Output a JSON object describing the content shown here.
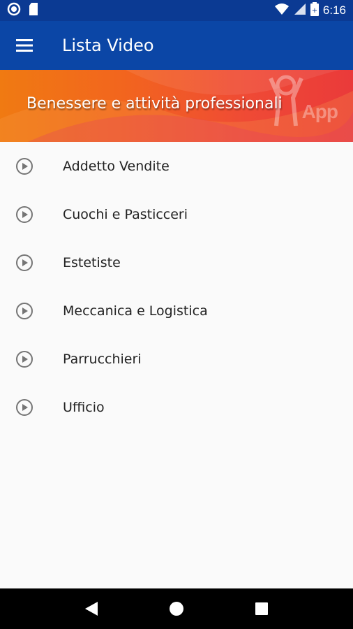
{
  "status_bar": {
    "time": "6:16",
    "icons": [
      "record-icon",
      "sd-card-icon",
      "wifi-icon",
      "signal-icon",
      "battery-icon"
    ]
  },
  "app_bar": {
    "title": "Lista Video",
    "menu_icon": "hamburger-menu-icon"
  },
  "banner": {
    "title": "Benessere e attività professionali",
    "logo_text": "App"
  },
  "video_list": {
    "items": [
      {
        "label": "Addetto Vendite",
        "icon": "play-circle-icon"
      },
      {
        "label": "Cuochi e Pasticceri",
        "icon": "play-circle-icon"
      },
      {
        "label": "Estetiste",
        "icon": "play-circle-icon"
      },
      {
        "label": "Meccanica e Logistica",
        "icon": "play-circle-icon"
      },
      {
        "label": "Parrucchieri",
        "icon": "play-circle-icon"
      },
      {
        "label": "Ufficio",
        "icon": "play-circle-icon"
      }
    ]
  },
  "nav_bar": {
    "buttons": [
      "back-icon",
      "home-icon",
      "recents-icon"
    ]
  },
  "colors": {
    "status_bar": "#0b3a93",
    "app_bar": "#0b46a6",
    "banner_start": "#f07a12",
    "banner_end": "#ea3a3a",
    "list_bg": "#fafafa",
    "icon_gray": "#757575"
  }
}
